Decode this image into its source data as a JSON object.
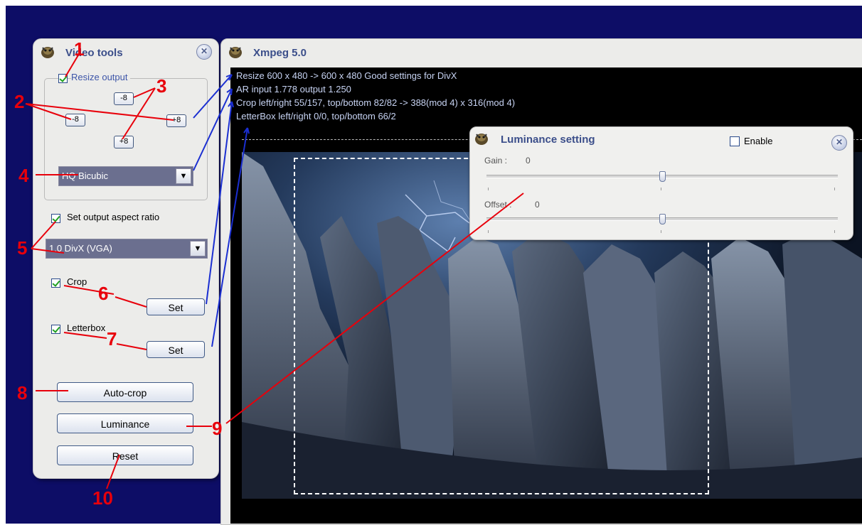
{
  "video_tools": {
    "title": "Video tools",
    "close": "✕",
    "resize_output_label": "Resize output",
    "btn_top": "-8",
    "btn_left": "-8",
    "btn_right": "+8",
    "btn_bottom": "+8",
    "resize_method": "HQ Bicubic",
    "aspect_ratio_label": "Set output aspect ratio",
    "aspect_ratio_value": "1.0 DivX (VGA)",
    "crop_label": "Crop",
    "crop_set": "Set",
    "letterbox_label": "Letterbox",
    "letterbox_set": "Set",
    "autocrop": "Auto-crop",
    "luminance": "Luminance",
    "reset": "Reset"
  },
  "xmpeg": {
    "title": "Xmpeg 5.0",
    "info": [
      "Resize 600 x 480 -> 600 x 480 Good settings for DivX",
      "AR input 1.778 output 1.250",
      "Crop left/right 55/157, top/bottom 82/82 -> 388(mod 4) x 316(mod 4)",
      "LetterBox left/right 0/0, top/bottom 66/2"
    ]
  },
  "luminance_dialog": {
    "title": "Luminance setting",
    "enable_label": "Enable",
    "close": "✕",
    "gain_label": "Gain :",
    "gain_value": "0",
    "offset_label": "Offset :",
    "offset_value": "0",
    "gain_level": 0.5,
    "offset_level": 0.5
  },
  "annotations": [
    "1",
    "2",
    "3",
    "4",
    "5",
    "6",
    "7",
    "8",
    "9",
    "10"
  ],
  "colors": {
    "desktop": "#0d0d66",
    "panel": "#ececea",
    "annotation": "#e8000b",
    "arrow_blue": "#1b2fd1",
    "title_text": "#3b4e8a"
  }
}
